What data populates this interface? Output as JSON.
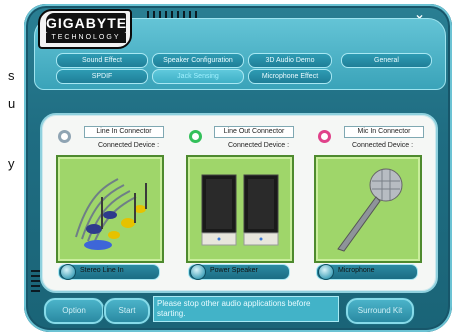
{
  "background_text": {
    "line1": "s",
    "line2": "u",
    "line3": "y"
  },
  "window": {
    "logo_main": "GIGABYTE",
    "logo_sub": "TECHNOLOGY",
    "minimize_label": "–",
    "close_label": "×"
  },
  "tabs": [
    {
      "label": "Sound Effect"
    },
    {
      "label": "Speaker Configuration"
    },
    {
      "label": "3D Audio Demo"
    },
    {
      "label": "General"
    },
    {
      "label": "SPDIF"
    },
    {
      "label": "Jack Sensing"
    },
    {
      "label": "Microphone Effect"
    }
  ],
  "active_tab": "Jack Sensing",
  "connectors": [
    {
      "title": "Line In Connector",
      "device_label": "Connected Device :",
      "device": "Stereo Line In",
      "ring_color": "#8fa4b3"
    },
    {
      "title": "Line Out Connector",
      "device_label": "Connected Device :",
      "device": "Power Speaker",
      "ring_color": "#33c05a"
    },
    {
      "title": "Mic In Connector",
      "device_label": "Connected Device :",
      "device": "Microphone",
      "ring_color": "#e0428a"
    }
  ],
  "buttons": {
    "option": "Option",
    "start": "Start",
    "surround": "Surround Kit"
  },
  "status_message": "Please stop other audio applications before starting.",
  "colors": {
    "frame": "#1f6d82",
    "panel_green": "#9fd66a",
    "accent": "#42b3c8"
  }
}
